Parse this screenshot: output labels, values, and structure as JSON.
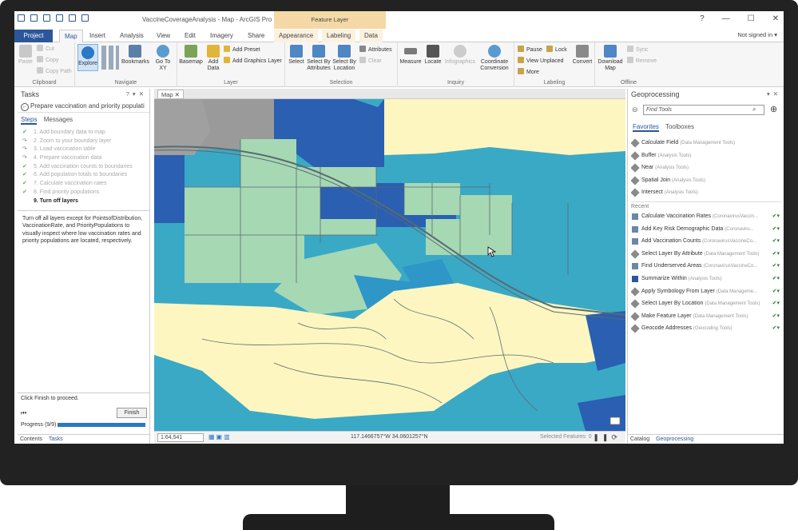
{
  "titlebar": {
    "app_title": "VaccineCoverageAnalysis - Map - ArcGIS Pro",
    "contextual_tab_group": "Feature Layer",
    "help": "?",
    "minimize": "—",
    "maximize": "☐",
    "close": "✕"
  },
  "tabs": [
    "Project",
    "Map",
    "Insert",
    "Analysis",
    "View",
    "Edit",
    "Imagery",
    "Share",
    "Appearance",
    "Labeling",
    "Data"
  ],
  "signin": "Not signed in ▾",
  "ribbon": {
    "clipboard": {
      "paste": "Paste",
      "cut": "Cut",
      "copy": "Copy",
      "copy_path": "Copy Path",
      "label": "Clipboard"
    },
    "navigate": {
      "explore": "Explore",
      "bookmarks": "Bookmarks",
      "goto": "Go To XY",
      "label": "Navigate"
    },
    "layer": {
      "basemap": "Basemap",
      "add_data": "Add Data",
      "add_preset": "Add Preset",
      "add_graphics": "Add Graphics Layer",
      "label": "Layer"
    },
    "selection": {
      "select": "Select",
      "by_attr": "Select By Attributes",
      "by_loc": "Select By Location",
      "attributes": "Attributes",
      "clear": "Clear",
      "label": "Selection"
    },
    "inquiry": {
      "measure": "Measure",
      "locate": "Locate",
      "infographics": "Infographics",
      "coord": "Coordinate Conversion",
      "label": "Inquiry"
    },
    "labeling": {
      "pause": "Pause",
      "lock": "Lock",
      "view_unplaced": "View Unplaced",
      "more": "More",
      "convert": "Convert",
      "label": "Labeling"
    },
    "offline": {
      "download": "Download Map",
      "sync": "Sync",
      "remove": "Remove",
      "label": "Offline"
    }
  },
  "tasks": {
    "header": "Tasks",
    "title": "Prepare vaccination and priority populati",
    "subtabs": [
      "Steps",
      "Messages"
    ],
    "steps": [
      {
        "num": "1.",
        "label": "Add boundary data to map",
        "mark": "✔"
      },
      {
        "num": "2.",
        "label": "Zoom to your boundary layer",
        "mark": "↷"
      },
      {
        "num": "3.",
        "label": "Load vaccination table",
        "mark": "↷"
      },
      {
        "num": "4.",
        "label": "Prepare vaccination data",
        "mark": "↷"
      },
      {
        "num": "5.",
        "label": "Add vaccination counts to boundaries",
        "mark": "✔"
      },
      {
        "num": "6.",
        "label": "Add population totals to boundaries",
        "mark": "✔"
      },
      {
        "num": "7.",
        "label": "Calculate vaccination rates",
        "mark": "✔"
      },
      {
        "num": "8.",
        "label": "Find priority populations",
        "mark": "✔"
      },
      {
        "num": "9.",
        "label": "Turn off layers",
        "mark": ""
      }
    ],
    "description": "Turn off all layers except for PointsofDistribution, VaccinationRate, and PriorityPopulations to visually inspect where low vaccination rates and priority populations are located, respectively.",
    "hint": "Click Finish to proceed.",
    "finish": "Finish",
    "progress_text": "Progress (9/9)",
    "progress": 1.0,
    "bottom_tabs": [
      "Contents",
      "Tasks"
    ]
  },
  "map": {
    "tab": "Map",
    "scale": "1:64,541",
    "coords": "117.1466757°W 34.0601257°N",
    "selected": "Selected Features: 0"
  },
  "geo": {
    "header": "Geoprocessing",
    "search_placeholder": "Find Tools",
    "tabs": [
      "Favorites",
      "Toolboxes"
    ],
    "favorites": [
      {
        "name": "Calculate Field",
        "box": "(Data Management Tools)"
      },
      {
        "name": "Buffer",
        "box": "(Analysis Tools)"
      },
      {
        "name": "Near",
        "box": "(Analysis Tools)"
      },
      {
        "name": "Spatial Join",
        "box": "(Analysis Tools)"
      },
      {
        "name": "Intersect",
        "box": "(Analysis Tools)"
      }
    ],
    "recent_label": "Recent",
    "recent": [
      {
        "name": "Calculate Vaccination Rates",
        "box": "(CoronavirusVaccin..."
      },
      {
        "name": "Add Key Risk Demographic Data",
        "box": "(Coronaviru..."
      },
      {
        "name": "Add Vaccination Counts",
        "box": "(CoronavirusVaccineCo..."
      },
      {
        "name": "Select Layer By Attribute",
        "box": "(Data Management Tools)"
      },
      {
        "name": "Find Underserved Areas",
        "box": "(CoronavirusVaccineCo..."
      },
      {
        "name": "Summarize Within",
        "box": "(Analysis Tools)"
      },
      {
        "name": "Apply Symbology From Layer",
        "box": "(Data Manageme..."
      },
      {
        "name": "Select Layer By Location",
        "box": "(Data Management Tools)"
      },
      {
        "name": "Make Feature Layer",
        "box": "(Data Management Tools)"
      },
      {
        "name": "Geocode Addresses",
        "box": "(Geocoding Tools)"
      }
    ],
    "bottom_tabs": [
      "Catalog",
      "Geoprocessing"
    ]
  },
  "colors": {
    "dark_blue": "#2a5fb2",
    "mid_blue": "#2f96c8",
    "teal": "#3aa9c6",
    "light_green": "#a6d8b4",
    "pale_yellow": "#fdf6c0",
    "gray": "#9a9a9a",
    "accent": "#2b579a"
  }
}
